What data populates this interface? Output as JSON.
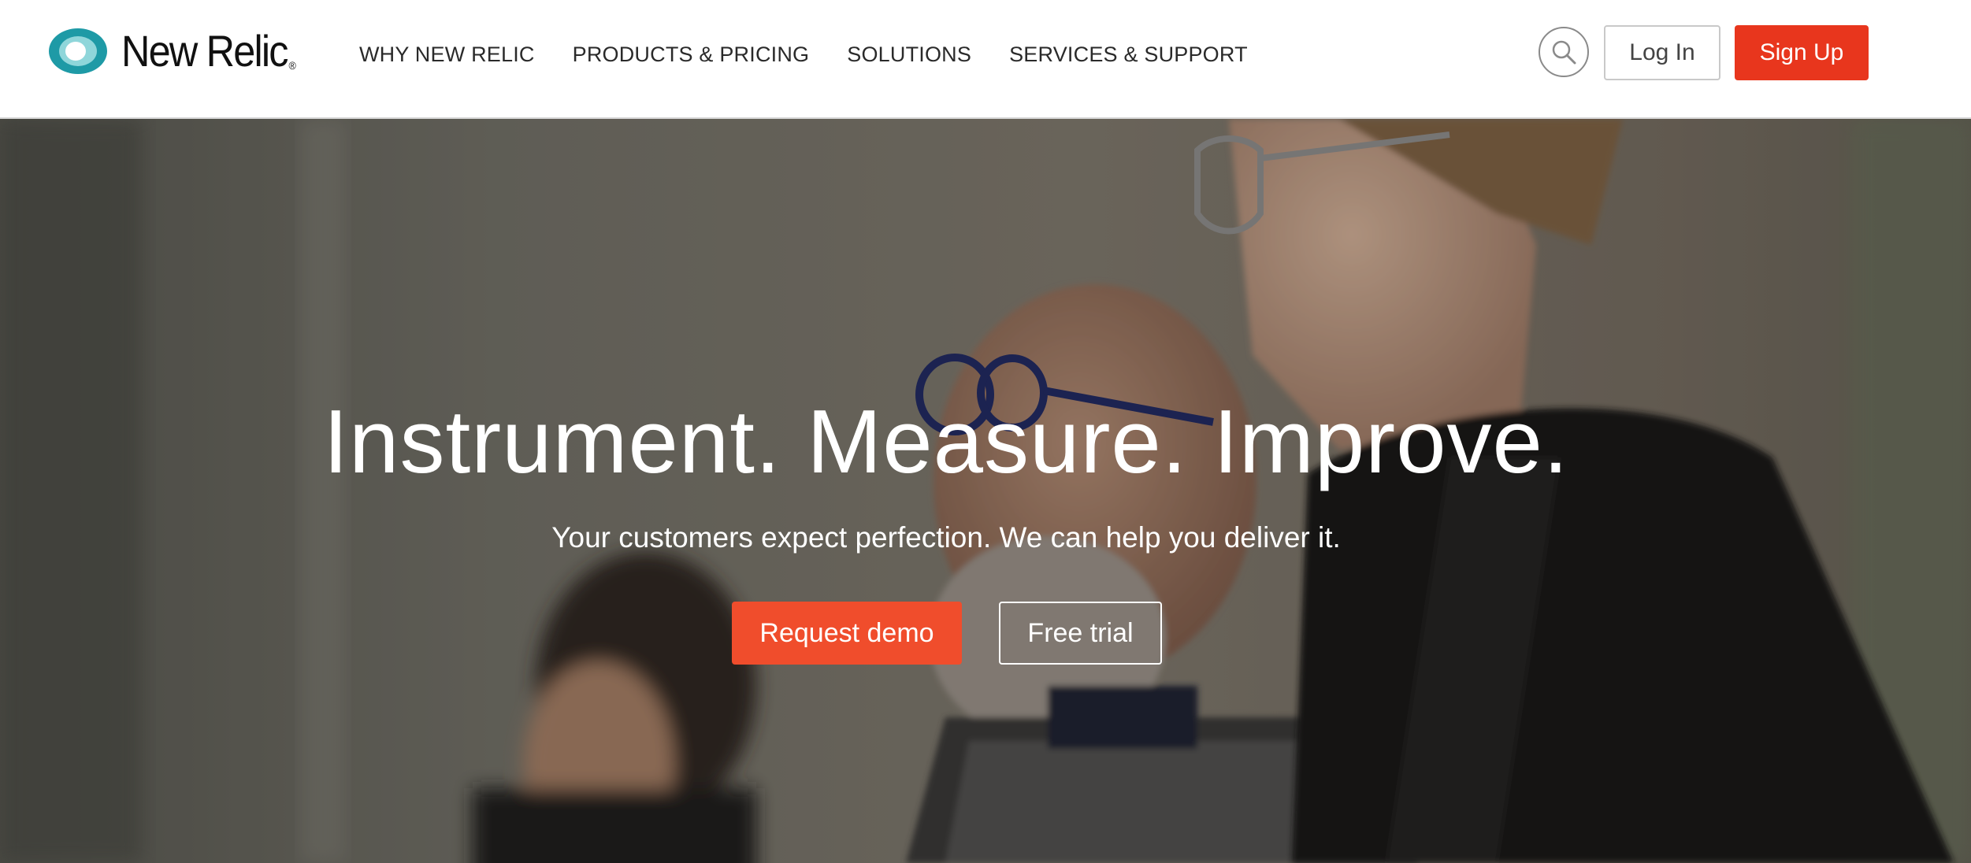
{
  "header": {
    "logo": {
      "text": "New Relic",
      "registered": "®",
      "icon": "new-relic-eye-logo"
    },
    "nav": [
      {
        "label": "WHY NEW RELIC"
      },
      {
        "label": "PRODUCTS & PRICING"
      },
      {
        "label": "SOLUTIONS"
      },
      {
        "label": "SERVICES & SUPPORT"
      }
    ],
    "search_icon": "search-icon",
    "login_label": "Log In",
    "signup_label": "Sign Up"
  },
  "hero": {
    "title": "Instrument. Measure. Improve.",
    "subtitle": "Your customers expect perfection. We can help you deliver it.",
    "primary_cta": "Request demo",
    "secondary_cta": "Free trial",
    "background_image": "people-smiling-office-photo"
  },
  "colors": {
    "brand_teal": "#1e9aa6",
    "signup_red": "#e8361d",
    "demo_orange": "#f04d2c",
    "nav_text": "#2a2a2a"
  }
}
